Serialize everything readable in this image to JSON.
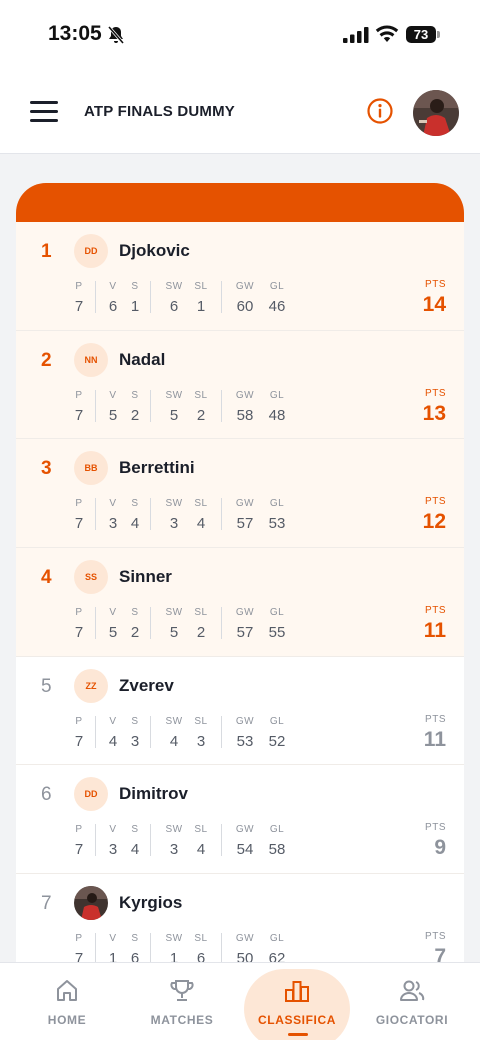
{
  "status_bar": {
    "time": "13:05",
    "battery": "73"
  },
  "header": {
    "title": "ATP FINALS DUMMY"
  },
  "stat_labels": {
    "p": "P",
    "v": "V",
    "s": "S",
    "sw": "SW",
    "sl": "SL",
    "gw": "GW",
    "gl": "GL",
    "pts": "PTS"
  },
  "standings": [
    {
      "pos": "1",
      "initials": "DD",
      "name": "Djokovic",
      "p": "7",
      "v": "6",
      "s": "1",
      "sw": "6",
      "sl": "1",
      "gw": "60",
      "gl": "46",
      "pts": "14",
      "qualified": true
    },
    {
      "pos": "2",
      "initials": "NN",
      "name": "Nadal",
      "p": "7",
      "v": "5",
      "s": "2",
      "sw": "5",
      "sl": "2",
      "gw": "58",
      "gl": "48",
      "pts": "13",
      "qualified": true
    },
    {
      "pos": "3",
      "initials": "BB",
      "name": "Berrettini",
      "p": "7",
      "v": "3",
      "s": "4",
      "sw": "3",
      "sl": "4",
      "gw": "57",
      "gl": "53",
      "pts": "12",
      "qualified": true
    },
    {
      "pos": "4",
      "initials": "SS",
      "name": "Sinner",
      "p": "7",
      "v": "5",
      "s": "2",
      "sw": "5",
      "sl": "2",
      "gw": "57",
      "gl": "55",
      "pts": "11",
      "qualified": true
    },
    {
      "pos": "5",
      "initials": "ZZ",
      "name": "Zverev",
      "p": "7",
      "v": "4",
      "s": "3",
      "sw": "4",
      "sl": "3",
      "gw": "53",
      "gl": "52",
      "pts": "11",
      "qualified": false
    },
    {
      "pos": "6",
      "initials": "DD",
      "name": "Dimitrov",
      "p": "7",
      "v": "3",
      "s": "4",
      "sw": "3",
      "sl": "4",
      "gw": "54",
      "gl": "58",
      "pts": "9",
      "qualified": false
    },
    {
      "pos": "7",
      "initials": "",
      "photo": true,
      "name": "Kyrgios",
      "p": "7",
      "v": "1",
      "s": "6",
      "sw": "1",
      "sl": "6",
      "gw": "50",
      "gl": "62",
      "pts": "7",
      "qualified": false
    }
  ],
  "nav": [
    {
      "label": "HOME",
      "icon": "home-icon",
      "active": false
    },
    {
      "label": "MATCHES",
      "icon": "trophy-icon",
      "active": false
    },
    {
      "label": "CLASSIFICA",
      "icon": "podium-icon",
      "active": true
    },
    {
      "label": "GIOCATORI",
      "icon": "users-icon",
      "active": false
    }
  ],
  "colors": {
    "accent": "#e55200",
    "accent_light": "#fde7d6",
    "highlight_row": "#fff8f1",
    "muted": "#8e939c"
  }
}
